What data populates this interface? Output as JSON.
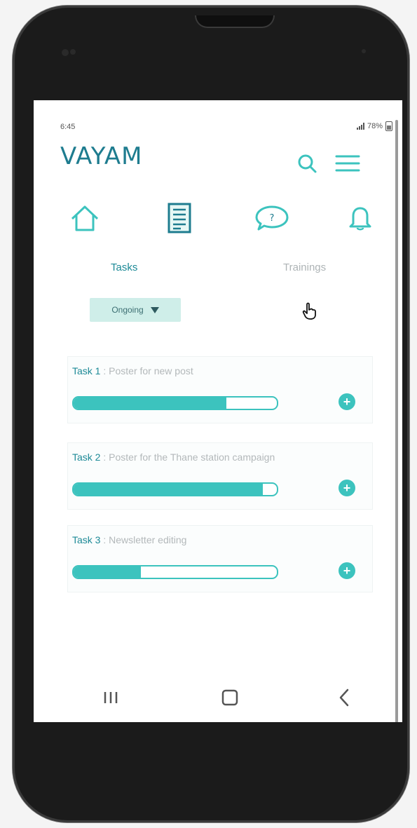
{
  "status_bar": {
    "time": "6:45",
    "battery": "78%"
  },
  "app": {
    "title": "VAYAM"
  },
  "header": {
    "icons": [
      "search-icon",
      "menu-icon"
    ]
  },
  "nav": {
    "icons": [
      "home-icon",
      "tasks-list-icon",
      "chat-help-icon",
      "bell-icon"
    ]
  },
  "tabs": {
    "tasks": "Tasks",
    "trainings": "Trainings",
    "active": "Tasks"
  },
  "filter": {
    "selected": "Ongoing"
  },
  "tasks": [
    {
      "number": "Task 1",
      "separator": " : ",
      "name": "Poster for new post",
      "progress": 0.75
    },
    {
      "number": "Task 2",
      "separator": " : ",
      "name": "Poster for the Thane station campaign",
      "progress": 0.93
    },
    {
      "number": "Task 3",
      "separator": " : ",
      "name": "Newsletter editing",
      "progress": 0.33
    }
  ],
  "system_nav": {
    "icons": [
      "recents-icon",
      "home-button-icon",
      "back-icon"
    ]
  },
  "colors": {
    "accent": "#3cc3be",
    "brand": "#1e7c8f",
    "filter_bg": "#cfeee9",
    "phone_body": "#1b1b1b"
  }
}
